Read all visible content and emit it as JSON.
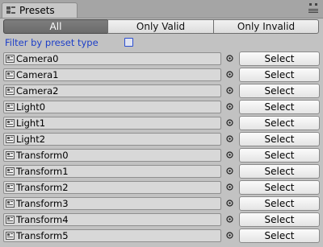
{
  "tab": {
    "title": "Presets",
    "icon": "presets-icon"
  },
  "window_menu_icon": "window-menu-icon",
  "toolbar": {
    "modes": [
      {
        "label": "All",
        "active": true
      },
      {
        "label": "Only Valid",
        "active": false
      },
      {
        "label": "Only Invalid",
        "active": false
      }
    ]
  },
  "filter": {
    "label": "Filter by preset type",
    "checked": false
  },
  "presets": [
    {
      "name": "Camera0",
      "button": "Select"
    },
    {
      "name": "Camera1",
      "button": "Select"
    },
    {
      "name": "Camera2",
      "button": "Select"
    },
    {
      "name": "Light0",
      "button": "Select"
    },
    {
      "name": "Light1",
      "button": "Select"
    },
    {
      "name": "Light2",
      "button": "Select"
    },
    {
      "name": "Transform0",
      "button": "Select"
    },
    {
      "name": "Transform1",
      "button": "Select"
    },
    {
      "name": "Transform2",
      "button": "Select"
    },
    {
      "name": "Transform3",
      "button": "Select"
    },
    {
      "name": "Transform4",
      "button": "Select"
    },
    {
      "name": "Transform5",
      "button": "Select"
    }
  ],
  "colors": {
    "filter_label": "#1d3fc8",
    "active_mode_bg": "#737373"
  }
}
